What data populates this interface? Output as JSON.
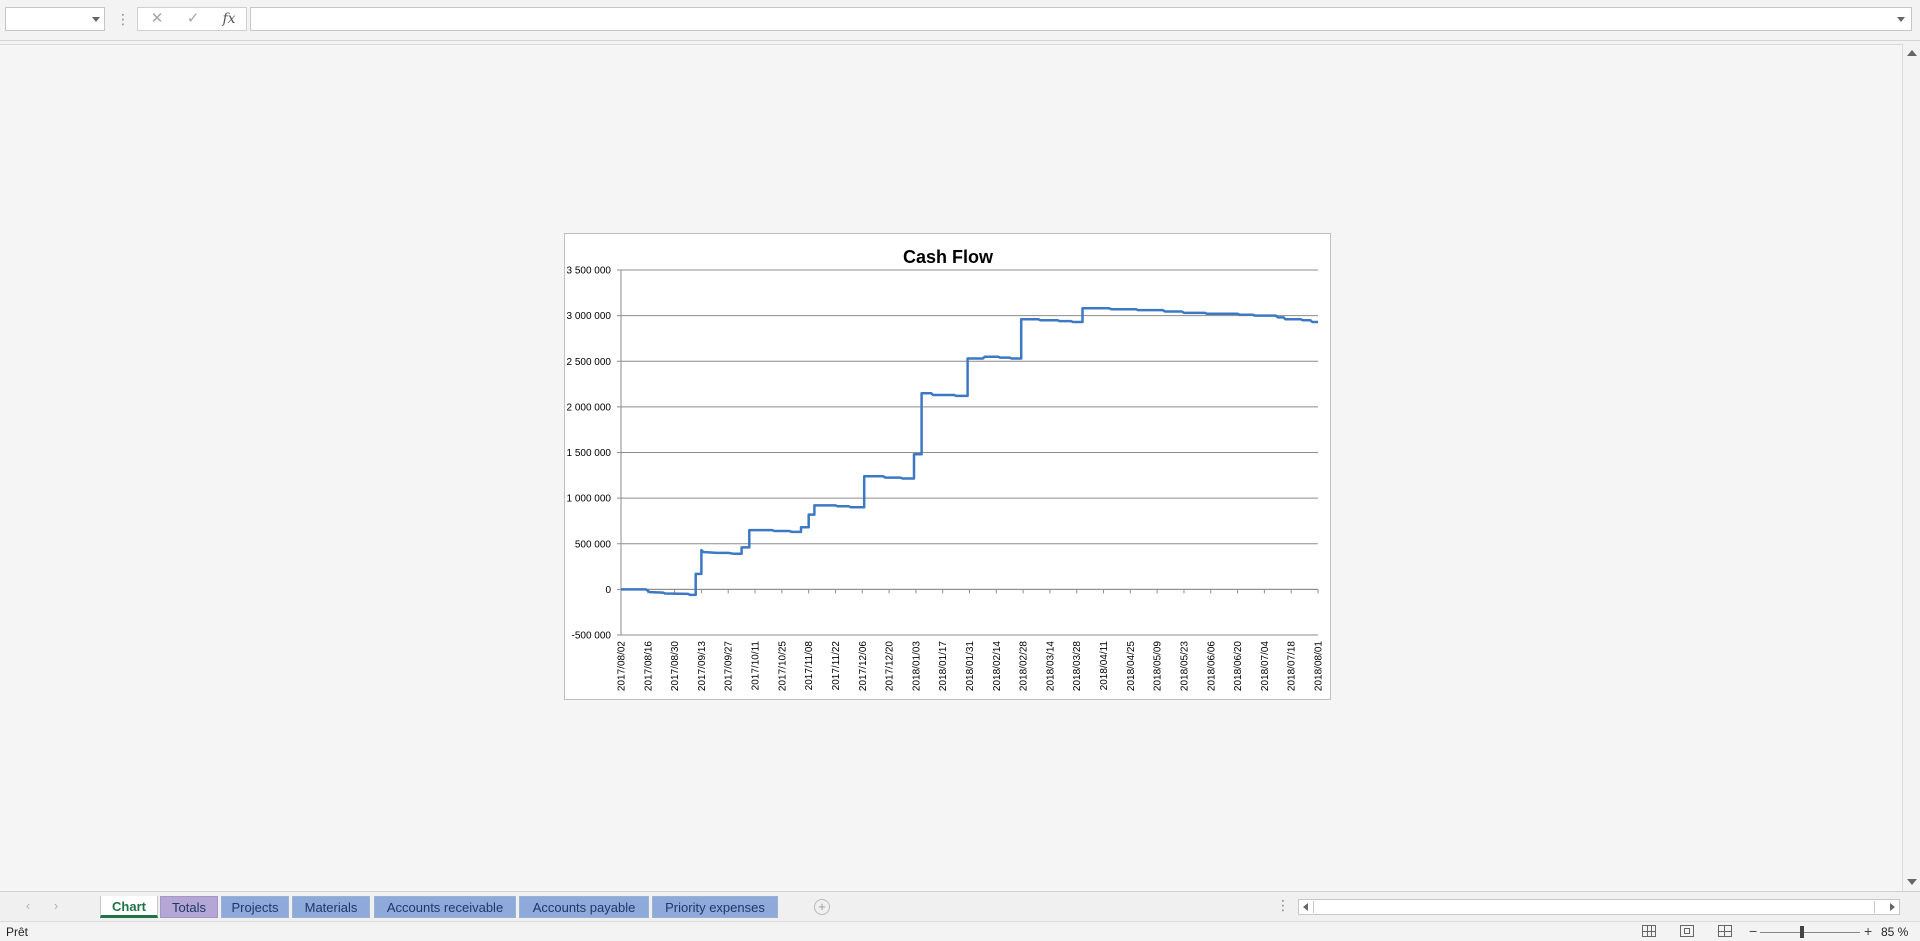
{
  "formula_bar": {
    "name_box_value": "",
    "cancel_icon": "close-icon",
    "confirm_icon": "check-icon",
    "function_label": "fx",
    "formula_value": ""
  },
  "chart_data": {
    "type": "line",
    "title": "Cash Flow",
    "xlabel": "",
    "ylabel": "",
    "ylim": [
      -500000,
      3500000
    ],
    "y_ticks": [
      -500000,
      0,
      500000,
      1000000,
      1500000,
      2000000,
      2500000,
      3000000,
      3500000
    ],
    "y_tick_labels": [
      "-500 000",
      "0",
      "500 000",
      "1 000 000",
      "1 500 000",
      "2 000 000",
      "2 500 000",
      "3 000 000",
      "3 500 000"
    ],
    "x_tick_labels": [
      "2017/08/02",
      "2017/08/16",
      "2017/08/30",
      "2017/09/13",
      "2017/09/27",
      "2017/10/11",
      "2017/10/25",
      "2017/11/08",
      "2017/11/22",
      "2017/12/06",
      "2017/12/20",
      "2018/01/03",
      "2018/01/17",
      "2018/01/31",
      "2018/02/14",
      "2018/02/28",
      "2018/03/14",
      "2018/03/28",
      "2018/04/11",
      "2018/04/25",
      "2018/05/09",
      "2018/05/23",
      "2018/06/06",
      "2018/06/20",
      "2018/07/04",
      "2018/07/18",
      "2018/08/01"
    ],
    "x_range": [
      "2017/08/02",
      "2018/08/01"
    ],
    "grid": true,
    "legend": "none",
    "line_color": "#3c78c3",
    "step_line": true,
    "series": [
      {
        "points": [
          [
            "2017/08/02",
            0
          ],
          [
            "2017/08/15",
            0
          ],
          [
            "2017/08/17",
            -30000
          ],
          [
            "2017/08/24",
            -35000
          ],
          [
            "2017/08/25",
            -45000
          ],
          [
            "2017/09/06",
            -50000
          ],
          [
            "2017/09/07",
            -60000
          ],
          [
            "2017/09/10",
            -60000
          ],
          [
            "2017/09/10",
            170000
          ],
          [
            "2017/09/13",
            170000
          ],
          [
            "2017/09/13",
            430000
          ],
          [
            "2017/09/14",
            410000
          ],
          [
            "2017/09/21",
            400000
          ],
          [
            "2017/09/27",
            400000
          ],
          [
            "2017/09/30",
            390000
          ],
          [
            "2017/10/04",
            390000
          ],
          [
            "2017/10/04",
            460000
          ],
          [
            "2017/10/08",
            460000
          ],
          [
            "2017/10/08",
            650000
          ],
          [
            "2017/10/20",
            650000
          ],
          [
            "2017/10/21",
            640000
          ],
          [
            "2017/10/29",
            640000
          ],
          [
            "2017/10/30",
            630000
          ],
          [
            "2017/11/04",
            630000
          ],
          [
            "2017/11/04",
            680000
          ],
          [
            "2017/11/08",
            680000
          ],
          [
            "2017/11/08",
            820000
          ],
          [
            "2017/11/11",
            820000
          ],
          [
            "2017/11/11",
            920000
          ],
          [
            "2017/11/22",
            920000
          ],
          [
            "2017/11/23",
            910000
          ],
          [
            "2017/11/29",
            910000
          ],
          [
            "2017/11/30",
            900000
          ],
          [
            "2017/12/07",
            900000
          ],
          [
            "2017/12/07",
            1240000
          ],
          [
            "2017/12/17",
            1240000
          ],
          [
            "2017/12/18",
            1225000
          ],
          [
            "2017/12/26",
            1225000
          ],
          [
            "2017/12/27",
            1215000
          ],
          [
            "2018/01/02",
            1215000
          ],
          [
            "2018/01/02",
            1480000
          ],
          [
            "2018/01/06",
            1480000
          ],
          [
            "2018/01/06",
            2150000
          ],
          [
            "2018/01/11",
            2150000
          ],
          [
            "2018/01/12",
            2130000
          ],
          [
            "2018/01/23",
            2130000
          ],
          [
            "2018/01/24",
            2120000
          ],
          [
            "2018/01/30",
            2120000
          ],
          [
            "2018/01/30",
            2530000
          ],
          [
            "2018/02/07",
            2530000
          ],
          [
            "2018/02/08",
            2550000
          ],
          [
            "2018/02/15",
            2550000
          ],
          [
            "2018/02/16",
            2540000
          ],
          [
            "2018/02/21",
            2540000
          ],
          [
            "2018/02/22",
            2530000
          ],
          [
            "2018/02/27",
            2530000
          ],
          [
            "2018/02/27",
            2960000
          ],
          [
            "2018/03/08",
            2960000
          ],
          [
            "2018/03/09",
            2950000
          ],
          [
            "2018/03/18",
            2950000
          ],
          [
            "2018/03/19",
            2940000
          ],
          [
            "2018/03/25",
            2940000
          ],
          [
            "2018/03/26",
            2930000
          ],
          [
            "2018/03/31",
            2930000
          ],
          [
            "2018/03/31",
            3080000
          ],
          [
            "2018/04/14",
            3080000
          ],
          [
            "2018/04/15",
            3070000
          ],
          [
            "2018/04/28",
            3070000
          ],
          [
            "2018/04/29",
            3060000
          ],
          [
            "2018/05/12",
            3060000
          ],
          [
            "2018/05/13",
            3045000
          ],
          [
            "2018/05/22",
            3045000
          ],
          [
            "2018/05/23",
            3030000
          ],
          [
            "2018/06/03",
            3030000
          ],
          [
            "2018/06/04",
            3020000
          ],
          [
            "2018/06/20",
            3020000
          ],
          [
            "2018/06/21",
            3010000
          ],
          [
            "2018/06/28",
            3010000
          ],
          [
            "2018/06/29",
            3000000
          ],
          [
            "2018/07/10",
            3000000
          ],
          [
            "2018/07/11",
            2980000
          ],
          [
            "2018/07/14",
            2980000
          ],
          [
            "2018/07/15",
            2960000
          ],
          [
            "2018/07/23",
            2960000
          ],
          [
            "2018/07/24",
            2950000
          ],
          [
            "2018/07/28",
            2950000
          ],
          [
            "2018/07/29",
            2930000
          ],
          [
            "2018/08/01",
            2930000
          ]
        ]
      }
    ]
  },
  "tabs": [
    {
      "label": "Chart",
      "style": "active"
    },
    {
      "label": "Totals",
      "style": "purple"
    },
    {
      "label": "Projects",
      "style": "blue"
    },
    {
      "label": "Materials",
      "style": "blue"
    },
    {
      "label": "Accounts receivable",
      "style": "blue"
    },
    {
      "label": "Accounts payable",
      "style": "blue"
    },
    {
      "label": "Priority expenses",
      "style": "blue"
    }
  ],
  "status_bar": {
    "status": "Prêt",
    "zoom_level": "85 %",
    "zoom_fraction": 0.42
  }
}
